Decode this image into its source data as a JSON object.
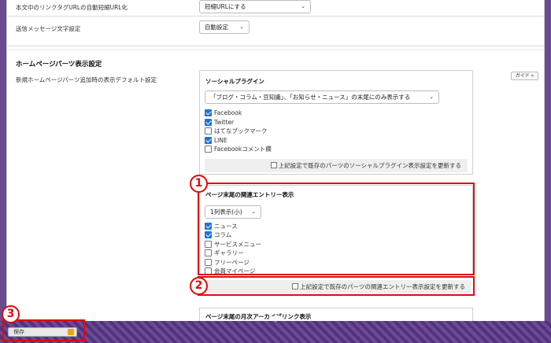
{
  "settings": {
    "rows": [
      {
        "label": "本文中のリンクタグURLの自動短縮URL化",
        "value": "短縮URLにする"
      },
      {
        "label": "送信メッセージ文字設定",
        "value": "自動設定"
      }
    ]
  },
  "section": {
    "title": "ホームページパーツ表示設定",
    "default_label": "新規ホームページパーツ追加時の表示デフォルト設定",
    "guide_label": "ガイド »"
  },
  "social": {
    "title": "ソーシャルプラグイン",
    "select_value": "「ブログ・コラム・豆知識」、「お知らせ・ニュース」の末尾にのみ表示する",
    "options": [
      {
        "label": "Facebook",
        "checked": true
      },
      {
        "label": "Twitter",
        "checked": true
      },
      {
        "label": "はてなブックマーク",
        "checked": false
      },
      {
        "label": "LINE",
        "checked": true
      },
      {
        "label": "Facebookコメント欄",
        "checked": false
      }
    ],
    "update_label": "上記設定で既存のパーツのソーシャルプラグイン表示設定を更新する"
  },
  "related": {
    "title": "ページ末尾の関連エントリー表示",
    "select_value": "1列表示(小)",
    "options": [
      {
        "label": "ニュース",
        "checked": true
      },
      {
        "label": "コラム",
        "checked": true
      },
      {
        "label": "サービスメニュー",
        "checked": false
      },
      {
        "label": "ギャラリー",
        "checked": false
      },
      {
        "label": "フリーページ",
        "checked": false
      },
      {
        "label": "会員マイページ",
        "checked": false
      }
    ],
    "update_label": "上記設定で既存のパーツの関連エントリー表示設定を更新する"
  },
  "archive": {
    "title": "ページ末尾の月次アーカイブリンク表示"
  },
  "annotations": {
    "one": "1",
    "two": "2",
    "three": "3"
  },
  "footer": {
    "save_label": "保存"
  },
  "colors": {
    "highlight": "#e00b0b",
    "check": "#1f73d8",
    "footer": "#5b3a80"
  }
}
